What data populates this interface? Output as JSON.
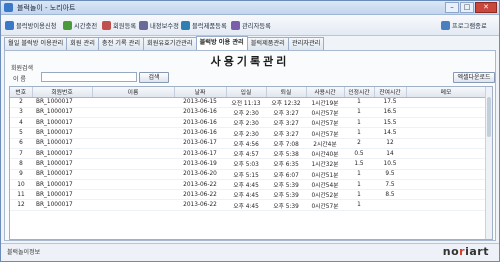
{
  "window": {
    "title": "블럭놀이 - 노리아트",
    "buttons": {
      "minimize": "–",
      "maximize": "□",
      "close": "✕"
    }
  },
  "toolbar": {
    "items": [
      {
        "label": "블럭방이용신청",
        "color": "#3a78c8"
      },
      {
        "label": "시간충전",
        "color": "#4a9a3c"
      },
      {
        "label": "회원등록",
        "color": "#c0504d"
      },
      {
        "label": "내정보수정",
        "color": "#6a6a9a"
      },
      {
        "label": "블럭제품등록",
        "color": "#2f7fb3"
      },
      {
        "label": "관리자등록",
        "color": "#7b5ea7"
      }
    ],
    "exit_label": "프로그램종료"
  },
  "tabs": [
    {
      "label": "월일 블럭방 이용관리",
      "active": false
    },
    {
      "label": "회원 관리",
      "active": false
    },
    {
      "label": "충전 기록 관리",
      "active": false
    },
    {
      "label": "회원유효기간관리",
      "active": false
    },
    {
      "label": "블럭방 이용 관리",
      "active": true
    },
    {
      "label": "블럭제품관리",
      "active": false
    },
    {
      "label": "관리자관리",
      "active": false
    }
  ],
  "page": {
    "title": "사용기록관리",
    "search_label": "회원검색",
    "name_label": "이     름",
    "search_value": "",
    "search_button": "검색",
    "excel_button": "엑셀다운로드"
  },
  "table": {
    "headers": [
      "번호",
      "회원번호",
      "이름",
      "날짜",
      "입실",
      "퇴실",
      "사용시간",
      "인정시간",
      "잔여시간",
      "메모"
    ],
    "rows": [
      [
        "2",
        "BR_1000017",
        "",
        "2013-06-15",
        "오전 11:13",
        "오후 12:32",
        "1시간19분",
        "1",
        "17.5",
        ""
      ],
      [
        "3",
        "BR_1000017",
        "",
        "2013-06-16",
        "오후 2:30",
        "오후 3:27",
        "0시간57분",
        "1",
        "16.5",
        ""
      ],
      [
        "4",
        "BR_1000017",
        "",
        "2013-06-16",
        "오후 2:30",
        "오후 3:27",
        "0시간57분",
        "1",
        "15.5",
        ""
      ],
      [
        "5",
        "BR_1000017",
        "",
        "2013-06-16",
        "오후 2:30",
        "오후 3:27",
        "0시간57분",
        "1",
        "14.5",
        ""
      ],
      [
        "6",
        "BR_1000017",
        "",
        "2013-06-17",
        "오후 4:56",
        "오후 7:08",
        "2시간4분",
        "2",
        "12",
        ""
      ],
      [
        "7",
        "BR_1000017",
        "",
        "2013-06-17",
        "오후 4:57",
        "오후 5:38",
        "0시간40분",
        "0.5",
        "14",
        ""
      ],
      [
        "8",
        "BR_1000017",
        "",
        "2013-06-19",
        "오후 5:03",
        "오후 6:35",
        "1시간32분",
        "1.5",
        "10.5",
        ""
      ],
      [
        "9",
        "BR_1000017",
        "",
        "2013-06-20",
        "오후 5:15",
        "오후 6:07",
        "0시간51분",
        "1",
        "9.5",
        ""
      ],
      [
        "10",
        "BR_1000017",
        "",
        "2013-06-22",
        "오후 4:45",
        "오후 5:39",
        "0시간54분",
        "1",
        "7.5",
        ""
      ],
      [
        "11",
        "BR_1000017",
        "",
        "2013-06-22",
        "오후 4:45",
        "오후 5:39",
        "0시간52분",
        "1",
        "8.5",
        ""
      ],
      [
        "12",
        "BR_1000017",
        "",
        "2013-06-22",
        "오후 4:45",
        "오후 5:39",
        "0시간57분",
        "1",
        "",
        ""
      ]
    ]
  },
  "status": {
    "text": "블럭놀이정보",
    "logo": "noriart"
  }
}
